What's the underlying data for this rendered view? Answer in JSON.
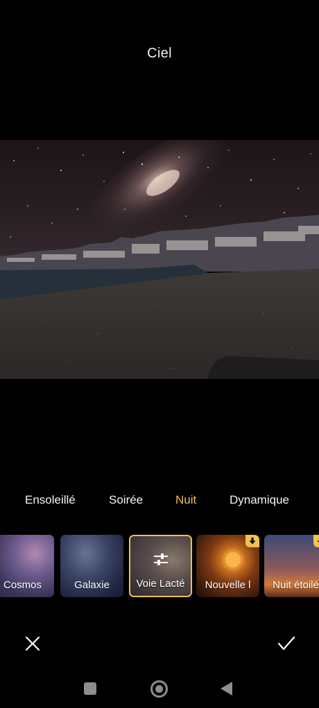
{
  "header": {
    "title": "Ciel"
  },
  "preview": {
    "description_icon": "photo-preview"
  },
  "tabs": [
    {
      "label": "Ensoleillé",
      "active": false
    },
    {
      "label": "Soirée",
      "active": false
    },
    {
      "label": "Nuit",
      "active": true
    },
    {
      "label": "Dynamique",
      "active": false
    }
  ],
  "presets": [
    {
      "label": "Cosmos",
      "selected": false,
      "download": false
    },
    {
      "label": "Galaxie",
      "selected": false,
      "download": false
    },
    {
      "label": "Voie Lacté",
      "selected": true,
      "download": false,
      "icon": "adjust-sliders-icon"
    },
    {
      "label": "Nouvelle l",
      "selected": false,
      "download": true
    },
    {
      "label": "Nuit étoilé",
      "selected": false,
      "download": true
    }
  ],
  "actions": {
    "cancel_icon": "close-icon",
    "confirm_icon": "check-icon"
  },
  "colors": {
    "accent": "#f2c14e",
    "background": "#000000"
  }
}
